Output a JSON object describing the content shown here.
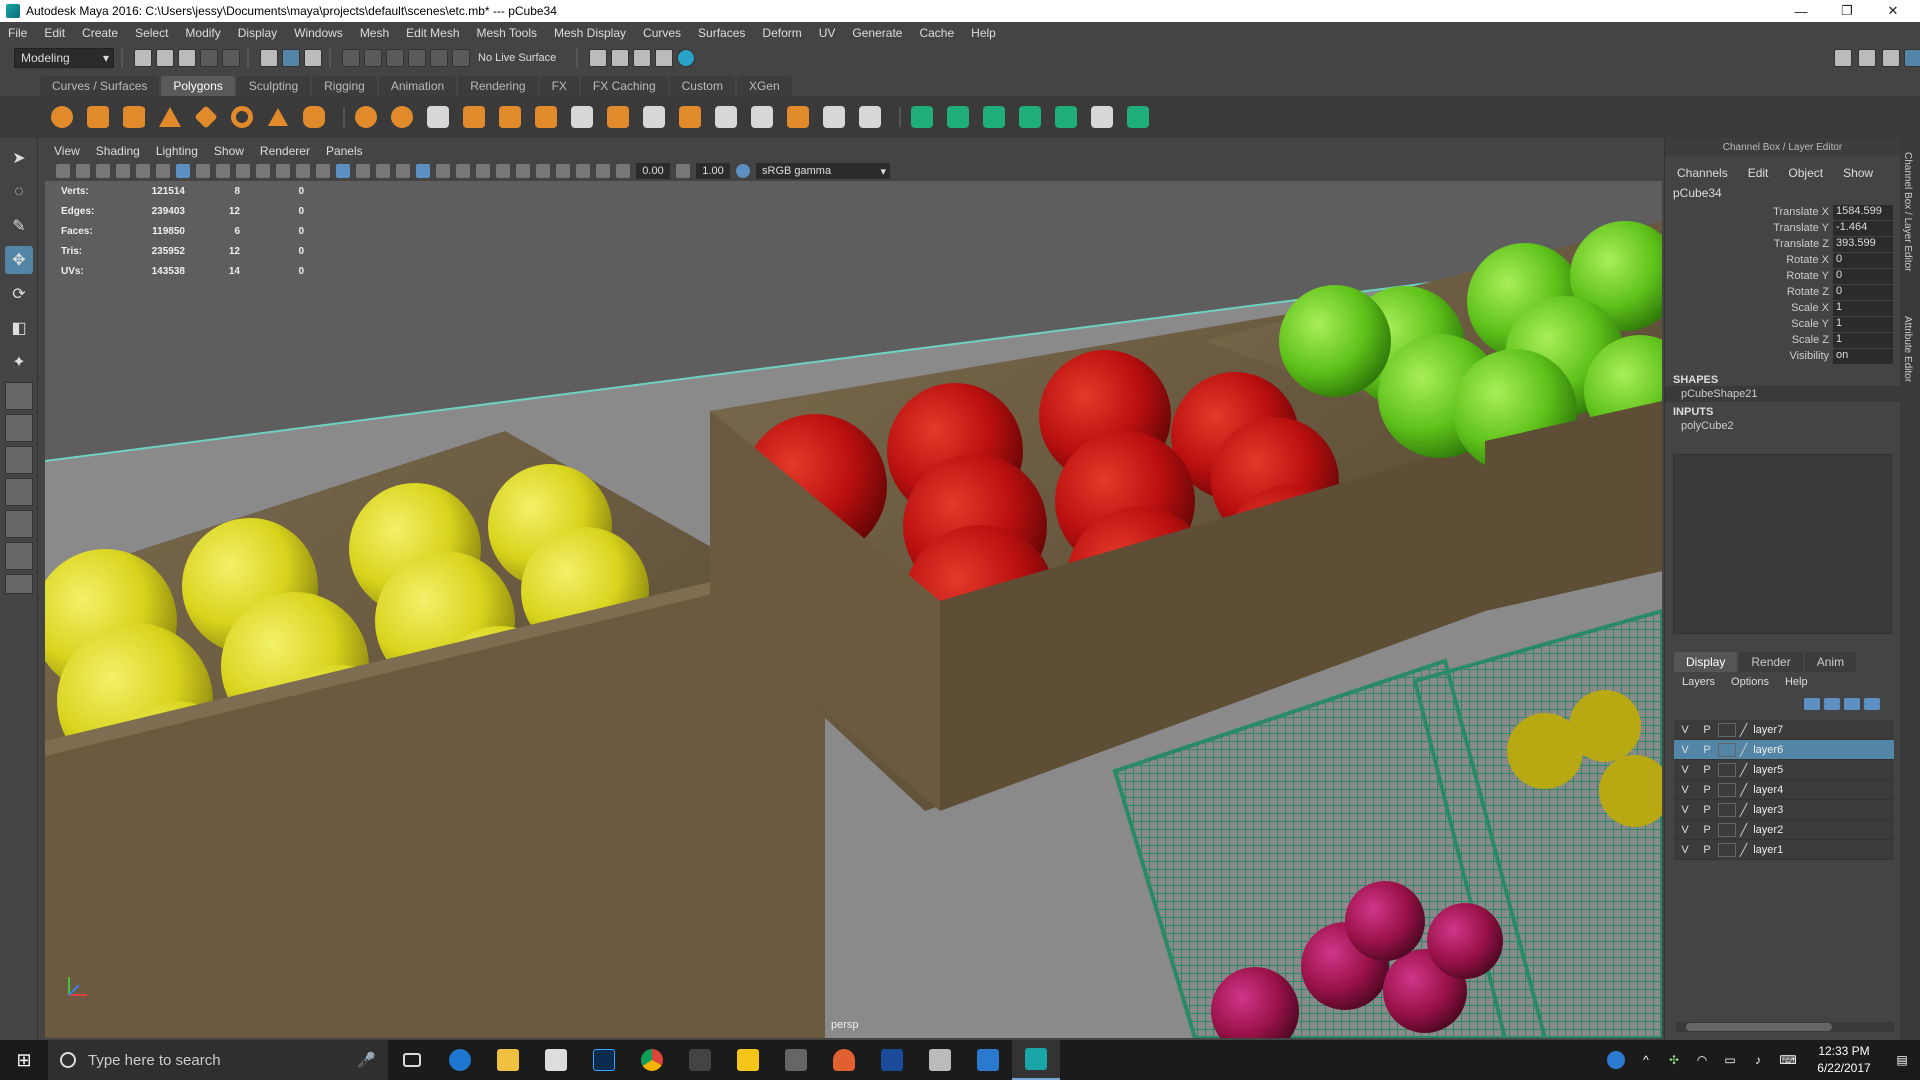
{
  "window": {
    "title": "Autodesk Maya 2016: C:\\Users\\jessy\\Documents\\maya\\projects\\default\\scenes\\etc.mb*   ---   pCube34",
    "minimize": "—",
    "restore": "❐",
    "close": "✕"
  },
  "menubar": [
    "File",
    "Edit",
    "Create",
    "Select",
    "Modify",
    "Display",
    "Windows",
    "Mesh",
    "Edit Mesh",
    "Mesh Tools",
    "Mesh Display",
    "Curves",
    "Surfaces",
    "Deform",
    "UV",
    "Generate",
    "Cache",
    "Help"
  ],
  "statusline": {
    "mode": "Modeling",
    "live_surface": "No Live Surface"
  },
  "shelf_tabs": [
    {
      "label": "Curves / Surfaces",
      "active": false
    },
    {
      "label": "Polygons",
      "active": true
    },
    {
      "label": "Sculpting",
      "active": false
    },
    {
      "label": "Rigging",
      "active": false
    },
    {
      "label": "Animation",
      "active": false
    },
    {
      "label": "Rendering",
      "active": false
    },
    {
      "label": "FX",
      "active": false
    },
    {
      "label": "FX Caching",
      "active": false
    },
    {
      "label": "Custom",
      "active": false
    },
    {
      "label": "XGen",
      "active": false
    }
  ],
  "panel_menu": [
    "View",
    "Shading",
    "Lighting",
    "Show",
    "Renderer",
    "Panels"
  ],
  "panel_toolbar": {
    "exposure": "0.00",
    "gamma": "1.00",
    "color_space": "sRGB gamma"
  },
  "hud": [
    {
      "label": "Verts:",
      "v1": "121514",
      "v2": "8",
      "v3": "0"
    },
    {
      "label": "Edges:",
      "v1": "239403",
      "v2": "12",
      "v3": "0"
    },
    {
      "label": "Faces:",
      "v1": "119850",
      "v2": "6",
      "v3": "0"
    },
    {
      "label": "Tris:",
      "v1": "235952",
      "v2": "12",
      "v3": "0"
    },
    {
      "label": "UVs:",
      "v1": "143538",
      "v2": "14",
      "v3": "0"
    }
  ],
  "viewport": {
    "camera": "persp"
  },
  "channel_box": {
    "header": "Channel Box / Layer Editor",
    "menu": [
      "Channels",
      "Edit",
      "Object",
      "Show"
    ],
    "object": "pCube34",
    "attributes": [
      {
        "name": "Translate X",
        "value": "1584.599"
      },
      {
        "name": "Translate Y",
        "value": "-1.464"
      },
      {
        "name": "Translate Z",
        "value": "393.599"
      },
      {
        "name": "Rotate X",
        "value": "0"
      },
      {
        "name": "Rotate Y",
        "value": "0"
      },
      {
        "name": "Rotate Z",
        "value": "0"
      },
      {
        "name": "Scale X",
        "value": "1"
      },
      {
        "name": "Scale Y",
        "value": "1"
      },
      {
        "name": "Scale Z",
        "value": "1"
      },
      {
        "name": "Visibility",
        "value": "on"
      }
    ],
    "shapes_label": "SHAPES",
    "shape": "pCubeShape21",
    "inputs_label": "INPUTS",
    "input": "polyCube2"
  },
  "layer_editor": {
    "tabs": [
      {
        "label": "Display",
        "active": true
      },
      {
        "label": "Render",
        "active": false
      },
      {
        "label": "Anim",
        "active": false
      }
    ],
    "menu": [
      "Layers",
      "Options",
      "Help"
    ],
    "layers": [
      {
        "v": "V",
        "p": "P",
        "name": "layer7",
        "selected": false
      },
      {
        "v": "V",
        "p": "P",
        "name": "layer6",
        "selected": true
      },
      {
        "v": "V",
        "p": "P",
        "name": "layer5",
        "selected": false
      },
      {
        "v": "V",
        "p": "P",
        "name": "layer4",
        "selected": false
      },
      {
        "v": "V",
        "p": "P",
        "name": "layer3",
        "selected": false
      },
      {
        "v": "V",
        "p": "P",
        "name": "layer2",
        "selected": false
      },
      {
        "v": "V",
        "p": "P",
        "name": "layer1",
        "selected": false
      }
    ]
  },
  "side_tabs": [
    "Channel Box / Layer Editor",
    "Attribute Editor"
  ],
  "taskbar": {
    "search_placeholder": "Type here to search",
    "time": "12:33 PM",
    "date": "6/22/2017",
    "icons": [
      "edge-icon",
      "file-explorer-icon",
      "store-icon",
      "photoshop-icon",
      "chrome-icon",
      "music-icon",
      "sticky-notes-icon",
      "calculator-icon",
      "paint-icon",
      "vudu-icon",
      "media-icon",
      "settings-icon",
      "maya-icon"
    ]
  },
  "colors": {
    "accent": "#5285a6",
    "apple_red": "#b80f0f",
    "apple_yellow": "#d8d41c",
    "apple_green": "#5fc21a",
    "crate_wood": "#6b5a40",
    "basket_green": "#2a8a66",
    "cherry": "#9a1248"
  }
}
